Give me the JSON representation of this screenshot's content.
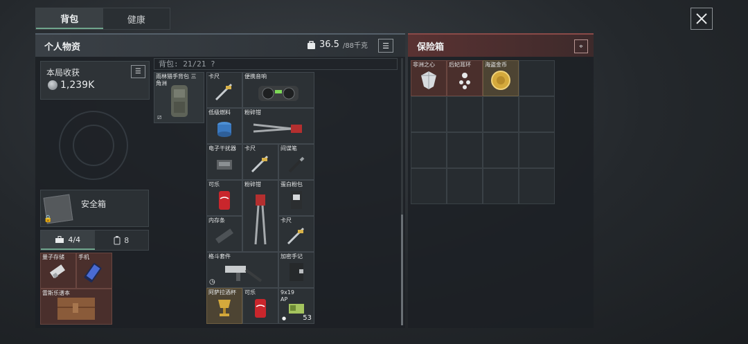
{
  "top_tabs": [
    {
      "label": "背包",
      "active": true
    },
    {
      "label": "健康",
      "active": false
    }
  ],
  "inventory": {
    "title": "个人物资",
    "weight_current": "36.5",
    "weight_max": "/88千克"
  },
  "earnings": {
    "label": "本局收获",
    "value": "1,239K"
  },
  "safe_box": {
    "label": "安全箱"
  },
  "pouch_tabs": [
    {
      "label": "4/4",
      "icon": "toolbox-icon",
      "active": true
    },
    {
      "label": "8",
      "icon": "canister-icon",
      "active": false
    }
  ],
  "safe_items": [
    {
      "name": "量子存储"
    },
    {
      "name": "手机"
    },
    {
      "name": "雷斯乐谱本"
    }
  ],
  "backpack": {
    "label": "背包: 21/21 ?",
    "item_name": "雨林猎手背包 三角洲"
  },
  "grid_items": [
    {
      "name": "卡尺"
    },
    {
      "name": "便携音响"
    },
    {
      "name": "低级燃料"
    },
    {
      "name": "粉碎钳"
    },
    {
      "name": "电子干扰器"
    },
    {
      "name": "卡尺"
    },
    {
      "name": "间谍笔"
    },
    {
      "name": "可乐"
    },
    {
      "name": "粉碎钳"
    },
    {
      "name": "蛋白粉包"
    },
    {
      "name": "内存条"
    },
    {
      "name": "卡尺"
    },
    {
      "name": "格斗套件"
    },
    {
      "name": "加密手记"
    },
    {
      "name": "阿萨拉酒杯"
    },
    {
      "name": "可乐"
    },
    {
      "name": "9x19 AP",
      "count": "53"
    }
  ],
  "vault": {
    "title": "保险箱",
    "items": [
      {
        "name": "非洲之心"
      },
      {
        "name": "后妃耳环"
      },
      {
        "name": "海盗金币"
      }
    ]
  },
  "colors": {
    "accent_green": "#6fa58c",
    "vault_red": "#8a4a48",
    "rare_red_cell": "#4a2f2c",
    "gold_cell": "#4d4433"
  }
}
